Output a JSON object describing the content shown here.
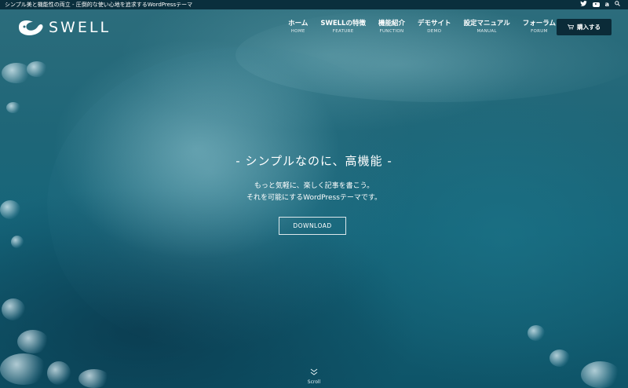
{
  "topbar": {
    "tagline": "シンプル美と機能性の両立 - 圧倒的な使い心地を追求するWordPressテーマ",
    "social_icons": [
      "twitter-icon",
      "youtube-icon",
      "amazon-icon",
      "search-icon"
    ]
  },
  "header": {
    "logo_text": "SWELL",
    "nav": [
      {
        "label": "ホーム",
        "sub": "HOME"
      },
      {
        "label": "SWELLの特徴",
        "sub": "FEATURE"
      },
      {
        "label": "機能紹介",
        "sub": "FUNCTION"
      },
      {
        "label": "デモサイト",
        "sub": "DEMO"
      },
      {
        "label": "設定マニュアル",
        "sub": "MANUAL"
      },
      {
        "label": "フォーラム",
        "sub": "FORUM"
      }
    ],
    "buy_label": "購入する"
  },
  "hero": {
    "catch": "- シンプルなのに、高機能 -",
    "sub_line1": "もっと気軽に、楽しく記事を書こう。",
    "sub_line2": "それを可能にするWordPressテーマです。",
    "download_label": "DOWNLOAD",
    "scroll_label": "Scroll"
  },
  "colors": {
    "topbar": "#0a2f3d",
    "buy_button": "#0b2b38",
    "text": "#ffffff"
  }
}
